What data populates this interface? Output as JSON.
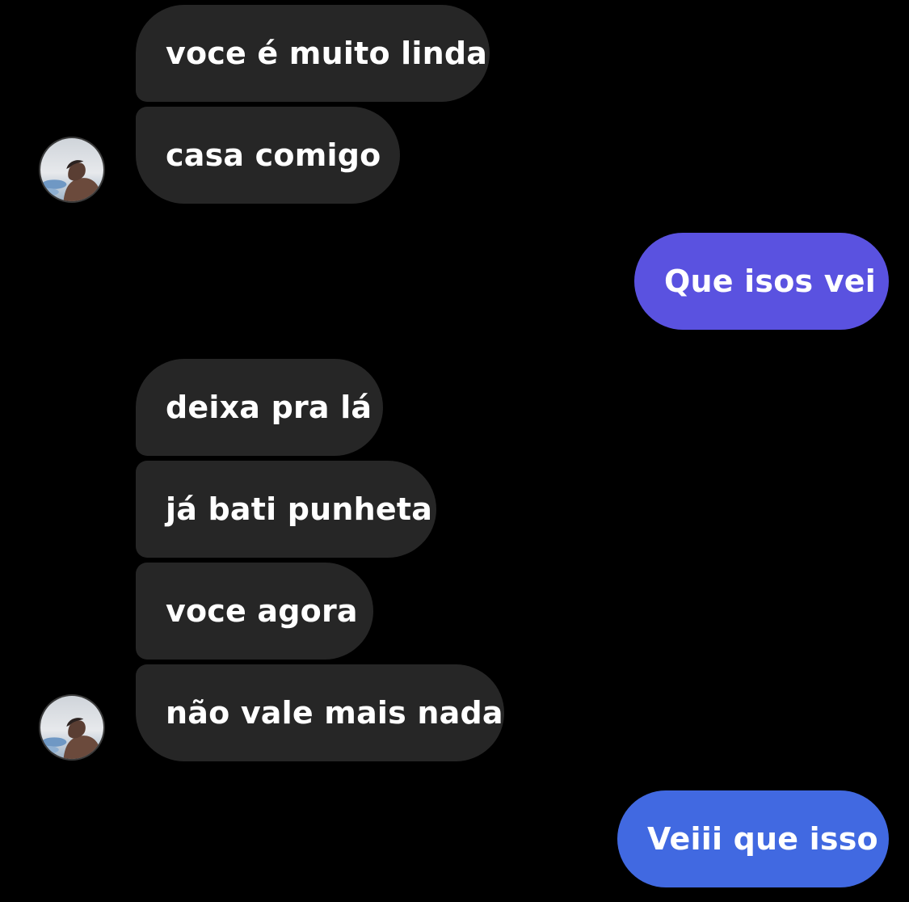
{
  "conversation": {
    "incoming_group_1": [
      {
        "text": "voce é muito linda"
      },
      {
        "text": "casa comigo"
      }
    ],
    "outgoing_1": {
      "text": "Que isos vei",
      "color": "#5a52e0"
    },
    "incoming_group_2": [
      {
        "text": "deixa pra lá"
      },
      {
        "text": "já bati punheta"
      },
      {
        "text": "voce agora"
      },
      {
        "text": "não vale mais nada"
      }
    ],
    "outgoing_2": {
      "text": "Veiii que isso",
      "color": "#4169e1"
    }
  },
  "colors": {
    "background": "#000000",
    "incoming_bubble": "#262626",
    "text": "#ffffff"
  },
  "icons": {
    "avatar": "profile-photo-avatar"
  }
}
